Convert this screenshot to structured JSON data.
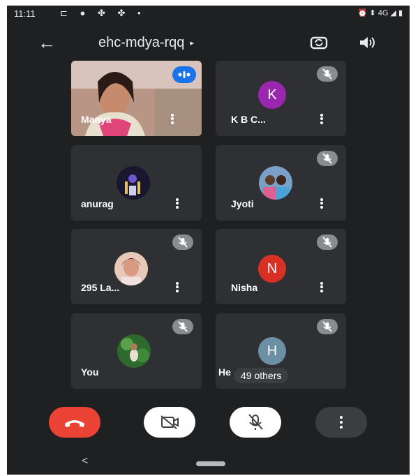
{
  "status": {
    "time": "11:11",
    "right": "⏰ ⬍ 4G ◢ ▮",
    "left_icons": "⊏ ● ✤ ✤ •"
  },
  "header": {
    "meeting_code": "ehc-mdya-rqq",
    "code_arrow": "▸"
  },
  "participants": [
    {
      "name": "Manya",
      "kind": "photo",
      "muted": false,
      "speaking": true
    },
    {
      "name": "K B C...",
      "kind": "letter",
      "letter": "K",
      "color": "#9b27b0",
      "muted": true
    },
    {
      "name": "anurag",
      "kind": "photo",
      "muted": false
    },
    {
      "name": "Jyoti",
      "kind": "photo",
      "muted": true
    },
    {
      "name": "295 La...",
      "kind": "photo",
      "muted": true
    },
    {
      "name": "Nisha",
      "kind": "letter",
      "letter": "N",
      "color": "#d93025",
      "muted": true
    },
    {
      "name": "You",
      "kind": "photo",
      "muted": true
    },
    {
      "name": "He",
      "kind": "letter",
      "letter": "H",
      "color": "#6b8fa3",
      "muted": true,
      "overlay": "49 others"
    }
  ],
  "colors": {
    "end_call": "#ea4335",
    "screen_bg": "#1f2022",
    "tile_bg": "#2f3033"
  },
  "nav": {
    "back": "<"
  }
}
